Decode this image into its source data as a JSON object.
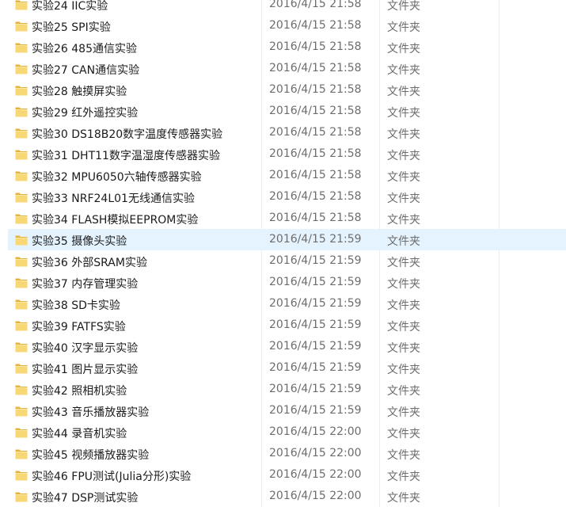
{
  "icon": "folder-icon",
  "colors": {
    "selection_bg": "#e5f3ff",
    "folder_yellow": "#f8d775",
    "folder_dark": "#e4b23e",
    "secondary_text": "#6d6d6d"
  },
  "rows": [
    {
      "name": "实验24 IIC实验",
      "date": "2016/4/15 21:58",
      "type": "文件夹"
    },
    {
      "name": "实验25 SPI实验",
      "date": "2016/4/15 21:58",
      "type": "文件夹"
    },
    {
      "name": "实验26 485通信实验",
      "date": "2016/4/15 21:58",
      "type": "文件夹"
    },
    {
      "name": "实验27 CAN通信实验",
      "date": "2016/4/15 21:58",
      "type": "文件夹"
    },
    {
      "name": "实验28 触摸屏实验",
      "date": "2016/4/15 21:58",
      "type": "文件夹"
    },
    {
      "name": "实验29 红外遥控实验",
      "date": "2016/4/15 21:58",
      "type": "文件夹"
    },
    {
      "name": "实验30 DS18B20数字温度传感器实验",
      "date": "2016/4/15 21:58",
      "type": "文件夹"
    },
    {
      "name": "实验31 DHT11数字温湿度传感器实验",
      "date": "2016/4/15 21:58",
      "type": "文件夹"
    },
    {
      "name": "实验32 MPU6050六轴传感器实验",
      "date": "2016/4/15 21:58",
      "type": "文件夹"
    },
    {
      "name": "实验33 NRF24L01无线通信实验",
      "date": "2016/4/15 21:58",
      "type": "文件夹"
    },
    {
      "name": "实验34 FLASH模拟EEPROM实验",
      "date": "2016/4/15 21:58",
      "type": "文件夹"
    },
    {
      "name": "实验35 摄像头实验",
      "date": "2016/4/15 21:59",
      "type": "文件夹",
      "selected": true
    },
    {
      "name": "实验36 外部SRAM实验",
      "date": "2016/4/15 21:59",
      "type": "文件夹"
    },
    {
      "name": "实验37 内存管理实验",
      "date": "2016/4/15 21:59",
      "type": "文件夹"
    },
    {
      "name": "实验38 SD卡实验",
      "date": "2016/4/15 21:59",
      "type": "文件夹"
    },
    {
      "name": "实验39 FATFS实验",
      "date": "2016/4/15 21:59",
      "type": "文件夹"
    },
    {
      "name": "实验40 汉字显示实验",
      "date": "2016/4/15 21:59",
      "type": "文件夹"
    },
    {
      "name": "实验41 图片显示实验",
      "date": "2016/4/15 21:59",
      "type": "文件夹"
    },
    {
      "name": "实验42 照相机实验",
      "date": "2016/4/15 21:59",
      "type": "文件夹"
    },
    {
      "name": "实验43 音乐播放器实验",
      "date": "2016/4/15 21:59",
      "type": "文件夹"
    },
    {
      "name": "实验44 录音机实验",
      "date": "2016/4/15 22:00",
      "type": "文件夹"
    },
    {
      "name": "实验45 视频播放器实验",
      "date": "2016/4/15 22:00",
      "type": "文件夹"
    },
    {
      "name": "实验46 FPU测试(Julia分形)实验",
      "date": "2016/4/15 22:00",
      "type": "文件夹"
    },
    {
      "name": "实验47 DSP测试实验",
      "date": "2016/4/15 22:00",
      "type": "文件夹"
    }
  ]
}
